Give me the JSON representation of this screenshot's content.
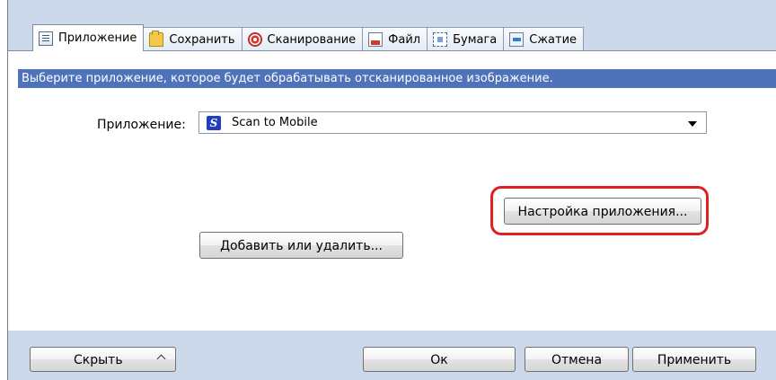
{
  "tabs": [
    {
      "label": "Приложение",
      "icon": "application-icon",
      "active": true
    },
    {
      "label": "Сохранить",
      "icon": "folder-icon",
      "active": false
    },
    {
      "label": "Сканирование",
      "icon": "scan-icon",
      "active": false
    },
    {
      "label": "Файл",
      "icon": "file-icon",
      "active": false
    },
    {
      "label": "Бумага",
      "icon": "paper-icon",
      "active": false
    },
    {
      "label": "Сжатие",
      "icon": "compression-icon",
      "active": false
    }
  ],
  "banner_text": "Выберите приложение, которое будет обрабатывать отсканированное изображение.",
  "application": {
    "label": "Приложение:",
    "selected": "Scan to Mobile",
    "selected_icon": "scan-to-mobile-icon"
  },
  "buttons": {
    "configure": "Настройка приложения...",
    "add_remove": "Добавить или удалить...",
    "hide": "Скрыть",
    "ok": "Ок",
    "cancel": "Отмена",
    "apply": "Применить"
  },
  "colors": {
    "banner_bg": "#4f73bb",
    "window_bg": "#ccd9eb",
    "highlight": "#e02020"
  }
}
